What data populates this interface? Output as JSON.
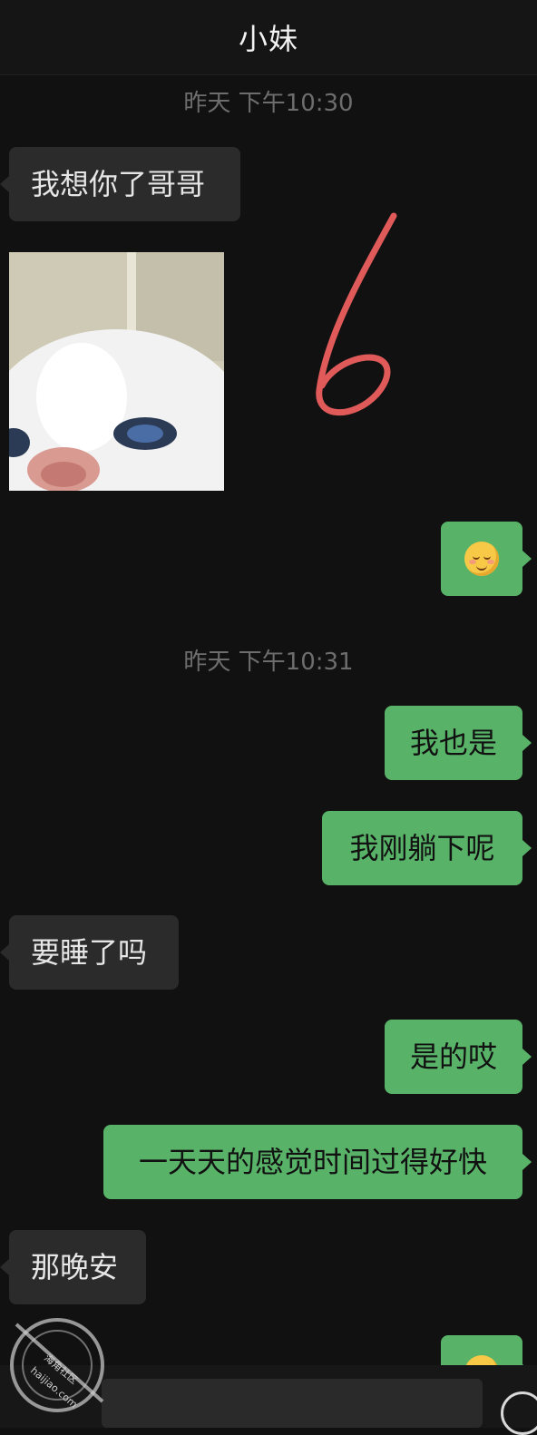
{
  "header": {
    "title": "小妹"
  },
  "timestamps": [
    "昨天 下午10:30",
    "昨天 下午10:31"
  ],
  "messages": [
    {
      "side": "in",
      "kind": "text",
      "text": "我想你了哥哥"
    },
    {
      "side": "in",
      "kind": "image",
      "description": "白猫自拍"
    },
    {
      "side": "out",
      "kind": "emoji",
      "emoji": "blushing-smile-emoji"
    },
    {
      "side": "out",
      "kind": "text",
      "text": "我也是"
    },
    {
      "side": "out",
      "kind": "text",
      "text": "我刚躺下呢"
    },
    {
      "side": "in",
      "kind": "text",
      "text": "要睡了吗"
    },
    {
      "side": "out",
      "kind": "text",
      "text": "是的哎"
    },
    {
      "side": "out",
      "kind": "text",
      "text": "一天天的感觉时间过得好快"
    },
    {
      "side": "in",
      "kind": "text",
      "text": "那晚安"
    },
    {
      "side": "out",
      "kind": "emoji",
      "emoji": "blushing-smile-emoji"
    }
  ],
  "watermark": {
    "line1": "海角社区",
    "line2": "haijiao.com"
  },
  "annotation": {
    "handwritten": "6"
  },
  "colors": {
    "background": "#111111",
    "incoming": "#2b2b2b",
    "outgoing": "#58b368",
    "mark": "#e05a5a"
  }
}
